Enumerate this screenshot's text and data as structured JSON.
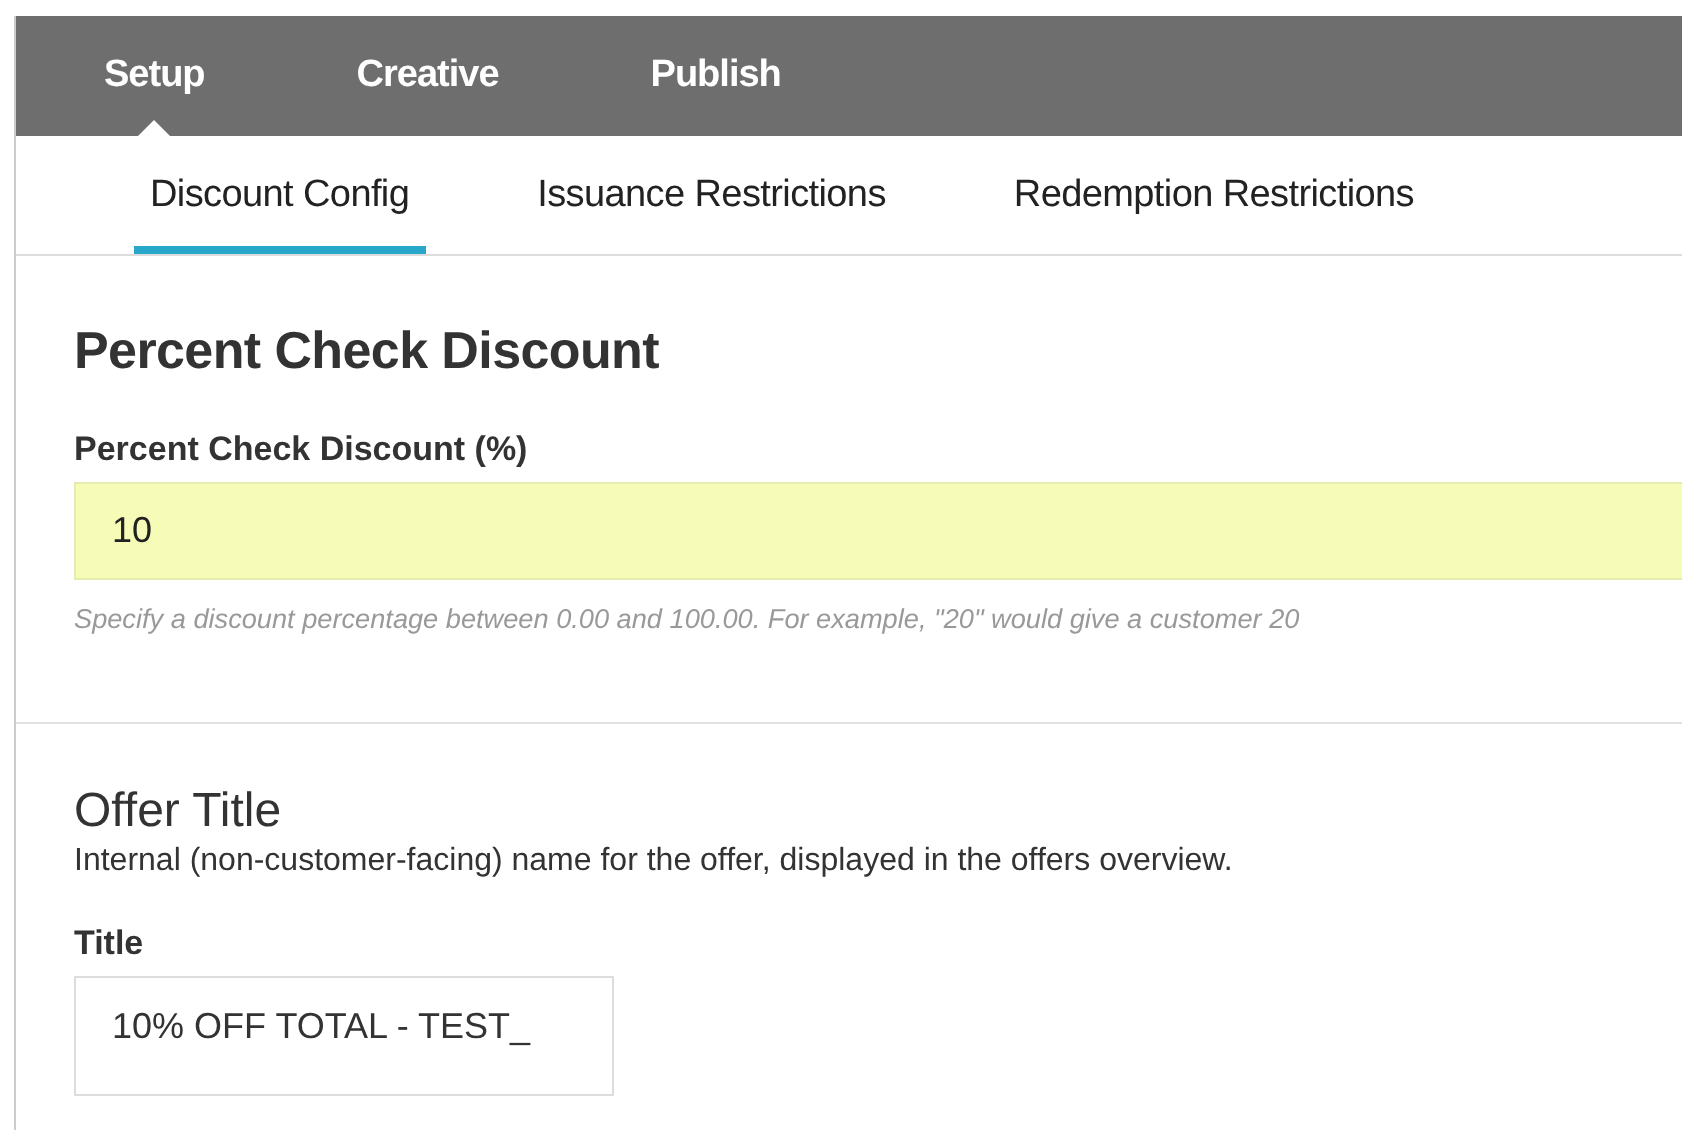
{
  "main_tabs": [
    {
      "label": "Setup",
      "selected": true
    },
    {
      "label": "Creative",
      "selected": false
    },
    {
      "label": "Publish",
      "selected": false
    }
  ],
  "sub_tabs": [
    {
      "label": "Discount Config",
      "selected": true
    },
    {
      "label": "Issuance Restrictions",
      "selected": false
    },
    {
      "label": "Redemption Restrictions",
      "selected": false
    }
  ],
  "discount_section": {
    "heading": "Percent Check Discount",
    "field_label": "Percent Check Discount (%)",
    "value": "10",
    "hint": "Specify a discount percentage between 0.00 and 100.00. For example, \"20\" would give a customer 20"
  },
  "offer_section": {
    "heading": "Offer Title",
    "description": "Internal (non-customer-facing) name for the offer, displayed in the offers overview.",
    "field_label": "Title",
    "value": "10% OFF TOTAL - TEST_"
  }
}
